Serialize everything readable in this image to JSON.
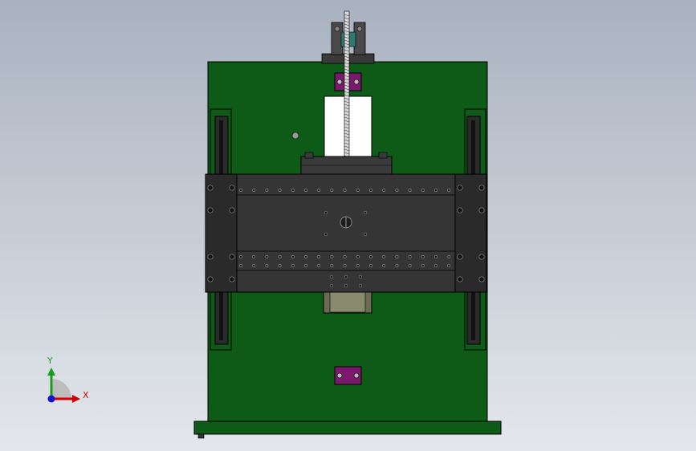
{
  "viewport": {
    "background_top": "#a9b2c0",
    "background_bottom": "#e4e7ec"
  },
  "colors": {
    "base_plate": "#0e5a17",
    "outline": "#000000",
    "carriage": "#353535",
    "carriage_dark": "#242424",
    "block": "#7b1a6c",
    "rail": "#2b2b2b",
    "window": "#ffffff"
  },
  "triad": {
    "x_label": "X",
    "y_label": "Y",
    "x_color": "#d00000",
    "y_color": "#1a9c1a",
    "z_color": "#1010d0",
    "icon": "axis-triad-icon"
  }
}
